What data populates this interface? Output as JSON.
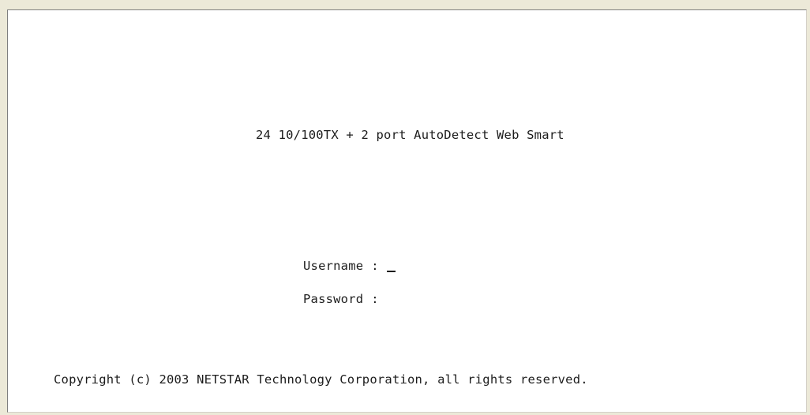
{
  "terminal": {
    "device_title": "24 10/100TX + 2 port AutoDetect Web Smart",
    "login": {
      "username_label": "Username",
      "password_label": "Password",
      "separator": ":",
      "username_value": "",
      "password_value": ""
    },
    "copyright": "Copyright (c) 2003 NETSTAR Technology Corporation, all rights reserved."
  }
}
